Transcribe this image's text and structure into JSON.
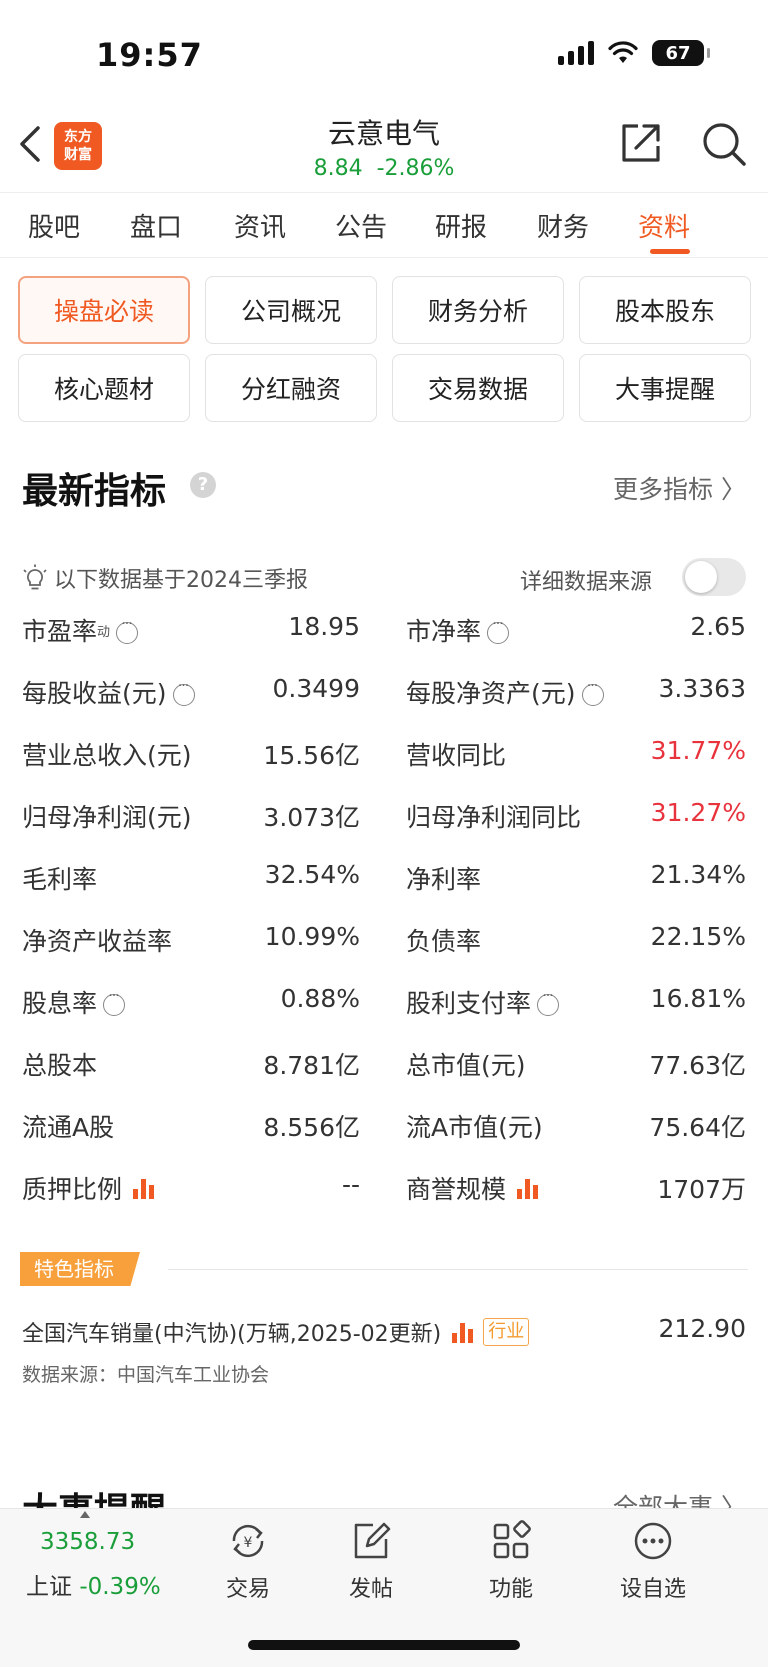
{
  "status_bar": {
    "time": "19:57",
    "battery": "67"
  },
  "header": {
    "logo_text_line1": "东方",
    "logo_text_line2": "财富",
    "stock_name": "云意电气",
    "price": "8.84",
    "change": "-2.86%"
  },
  "tabs": [
    {
      "label": "股吧"
    },
    {
      "label": "盘口"
    },
    {
      "label": "资讯"
    },
    {
      "label": "公告"
    },
    {
      "label": "研报"
    },
    {
      "label": "财务"
    },
    {
      "label": "资料",
      "active": true
    }
  ],
  "grid_buttons": [
    {
      "label": "操盘必读",
      "active": true
    },
    {
      "label": "公司概况"
    },
    {
      "label": "财务分析"
    },
    {
      "label": "股本股东"
    },
    {
      "label": "核心题材"
    },
    {
      "label": "分红融资"
    },
    {
      "label": "交易数据"
    },
    {
      "label": "大事提醒"
    }
  ],
  "indicators": {
    "title": "最新指标",
    "help_glyph": "?",
    "more": "更多指标 〉",
    "basis": "以下数据基于2024三季报",
    "source_toggle_label": "详细数据来源",
    "source_toggle_on": false,
    "pe_label": "市盈率",
    "pe_sup": "动",
    "rows": [
      {
        "l_label": "",
        "l_value": "18.95",
        "r_label": "市净率",
        "r_value": "2.65"
      },
      {
        "l_label": "每股收益(元)",
        "l_value": "0.3499",
        "r_label": "每股净资产(元)",
        "r_value": "3.3363"
      },
      {
        "l_label": "营业总收入(元)",
        "l_value": "15.56亿",
        "r_label": "营收同比",
        "r_value": "31.77%"
      },
      {
        "l_label": "归母净利润(元)",
        "l_value": "3.073亿",
        "r_label": "归母净利润同比",
        "r_value": "31.27%"
      },
      {
        "l_label": "毛利率",
        "l_value": "32.54%",
        "r_label": "净利率",
        "r_value": "21.34%"
      },
      {
        "l_label": "净资产收益率",
        "l_value": "10.99%",
        "r_label": "负债率",
        "r_value": "22.15%"
      },
      {
        "l_label": "股息率",
        "l_value": "0.88%",
        "r_label": "股利支付率",
        "r_value": "16.81%"
      },
      {
        "l_label": "总股本",
        "l_value": "8.781亿",
        "r_label": "总市值(元)",
        "r_value": "77.63亿"
      },
      {
        "l_label": "流通A股",
        "l_value": "8.556亿",
        "r_label": "流A市值(元)",
        "r_value": "75.64亿"
      },
      {
        "l_label": "质押比例",
        "l_value": "--",
        "r_label": "商誉规模",
        "r_value": "1707万"
      }
    ]
  },
  "feature": {
    "tag": "特色指标",
    "name": "全国汽车销量(中汽协)(万辆,2025-02更新)",
    "industry_tag": "行业",
    "value": "212.90",
    "source": "数据来源：中国汽车工业协会"
  },
  "next_section": {
    "title": "大事提醒",
    "link": "全部大事 〉"
  },
  "bottom_bar": {
    "index_value": "3358.73",
    "index_name": "上证",
    "index_change": "-0.39%",
    "items": [
      {
        "label": "交易",
        "icon": "exchange-icon"
      },
      {
        "label": "发帖",
        "icon": "edit-icon"
      },
      {
        "label": "功能",
        "icon": "grid-icon"
      },
      {
        "label": "设自选",
        "icon": "more-icon"
      }
    ]
  },
  "colors": {
    "accent": "#f05a22",
    "up": "#e8323c",
    "down": "#1a9e3a",
    "feature_tag": "#f7a03c"
  }
}
